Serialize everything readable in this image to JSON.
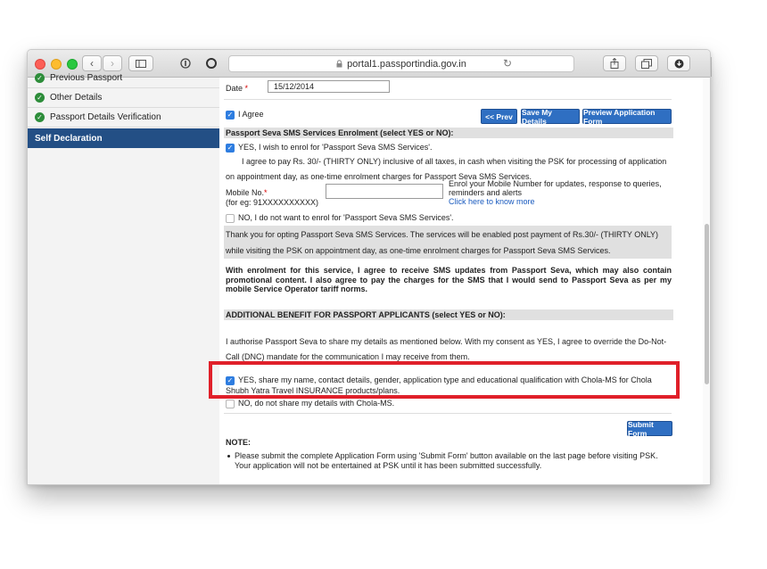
{
  "browser": {
    "url": "portal1.passportindia.gov.in",
    "lock_icon": "lock-icon",
    "nav_back_icon": "chevron-left-icon",
    "nav_forward_icon": "chevron-right-icon",
    "reload_icon": "reload-icon"
  },
  "sidebar": {
    "items": [
      {
        "label": "Previous Passport",
        "icon": "check-circle-icon"
      },
      {
        "label": "Other Details",
        "icon": "check-circle-icon"
      },
      {
        "label": "Passport Details Verification",
        "icon": "check-circle-icon"
      },
      {
        "label": "Self Declaration",
        "active": true
      }
    ],
    "active_color": "#234f85"
  },
  "form": {
    "date_label": "Date",
    "date_value": "15/12/2014",
    "agree_label": "I Agree",
    "buttons": {
      "prev": "<< Prev",
      "save": "Save My Details",
      "preview": "Preview Application Form",
      "submit": "Submit Form"
    },
    "sms": {
      "heading": "Passport Seva SMS Services Enrolment (select YES or NO):",
      "yes_label": "YES, I wish to enrol for 'Passport Seva SMS Services'.",
      "agree_text": "I agree to pay Rs. 30/- (THIRTY ONLY) inclusive of all taxes, in cash when visiting the PSK for processing of application on appointment day, as one-time enrolment charges for Passport Seva SMS Services.",
      "mobile_label": "Mobile No.",
      "mobile_example": "(for eg: 91XXXXXXXXXX)",
      "mobile_value": "",
      "mobile_help": "Enrol your Mobile Number for updates, response to queries, reminders and alerts",
      "know_more_link": "Click here to know more",
      "no_label": "NO, I do not want to enrol for 'Passport Seva SMS Services'.",
      "thanks_text": "Thank you for opting Passport Seva SMS Services. The services will be enabled post payment of Rs.30/- (THIRTY ONLY) while visiting the PSK on appointment day, as one-time enrolment charges for Passport Seva SMS Services.",
      "bold_text": "With enrolment for this service, I agree to receive SMS updates from Passport Seva, which may also contain promotional content. I also agree to pay the charges for the SMS that I would send to Passport Seva as per my mobile Service Operator tariff norms."
    },
    "benefit": {
      "heading": "ADDITIONAL BENEFIT FOR PASSPORT APPLICANTS (select YES or NO):",
      "authorise_text": "I authorise Passport Seva to share my details as mentioned below. With my consent as YES, I agree to override the Do-Not-Call (DNC) mandate for the communication I may receive from them.",
      "yes_label": "YES, share my name, contact details, gender, application type and educational qualification with Chola-MS for Chola Shubh Yatra Travel INSURANCE products/plans.",
      "no_label": "NO, do not share my details with Chola-MS."
    },
    "note": {
      "heading": "NOTE:",
      "items": [
        "Please submit the complete Application Form using 'Submit Form' button available on the last page before visiting PSK. Your application will not be entertained at PSK until it has been submitted successfully."
      ]
    }
  },
  "colors": {
    "button_blue": "#2f6fc2",
    "highlight_red": "#e0202a",
    "required_red": "#d40000",
    "link_blue": "#1a5bbf"
  }
}
